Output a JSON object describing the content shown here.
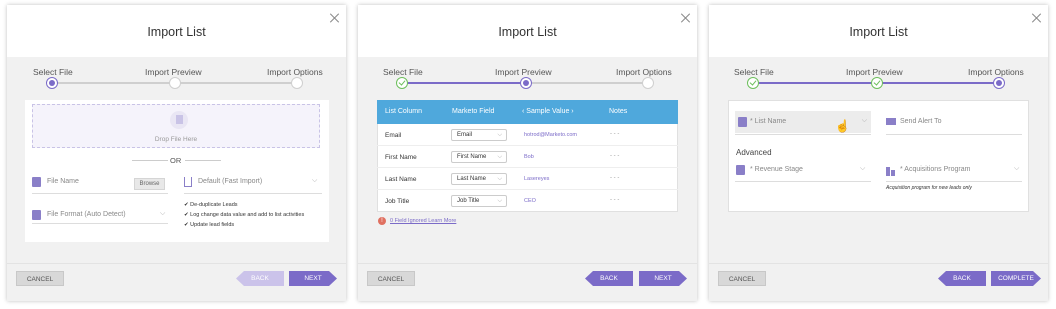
{
  "panels": [
    {
      "title": "Import List",
      "steps": [
        "Select File",
        "Import Preview",
        "Import Options"
      ],
      "drop_label": "Drop File Here",
      "or_label": "OR",
      "file_name_label": "File Name",
      "browse_label": "Browse",
      "file_format_label": "File Format (Auto Detect)",
      "default_label": "Default (Fast Import)",
      "checks": [
        "De-duplicate Leads",
        "Log change data value and add to list activities",
        "Update lead fields"
      ],
      "cancel": "CANCEL",
      "back": "BACK",
      "next": "NEXT"
    },
    {
      "title": "Import List",
      "steps": [
        "Select File",
        "Import Preview",
        "Import Options"
      ],
      "headers": [
        "List Column",
        "Marketo Field",
        "Sample Value",
        "Notes"
      ],
      "rows": [
        {
          "col": "Email",
          "field": "Email",
          "sample": "hotrod@Marketo.com",
          "notes": "- - -"
        },
        {
          "col": "First Name",
          "field": "First Name",
          "sample": "Bob",
          "notes": "- - -"
        },
        {
          "col": "Last Name",
          "field": "Last Name",
          "sample": "Lasereyes",
          "notes": "- - -"
        },
        {
          "col": "Job Title",
          "field": "Job Title",
          "sample": "CEO",
          "notes": "- - -"
        }
      ],
      "ignored_label": "0 Field Ignored Learn More",
      "cancel": "CANCEL",
      "back": "BACK",
      "next": "NEXT"
    },
    {
      "title": "Import List",
      "steps": [
        "Select File",
        "Import Preview",
        "Import Options"
      ],
      "list_name_label": "* List Name",
      "send_alert_label": "Send Alert To",
      "advanced_label": "Advanced",
      "revenue_stage_label": "* Revenue Stage",
      "acq_program_label": "* Acquisitions Program",
      "acq_note": "Acquisition program for new leads only",
      "cancel": "CANCEL",
      "back": "BACK",
      "complete": "COMPLETE"
    }
  ],
  "colors": {
    "accent": "#7b6bc8",
    "table_header": "#4fa8dc",
    "done": "#6dbf5c",
    "warning": "#e07060"
  }
}
